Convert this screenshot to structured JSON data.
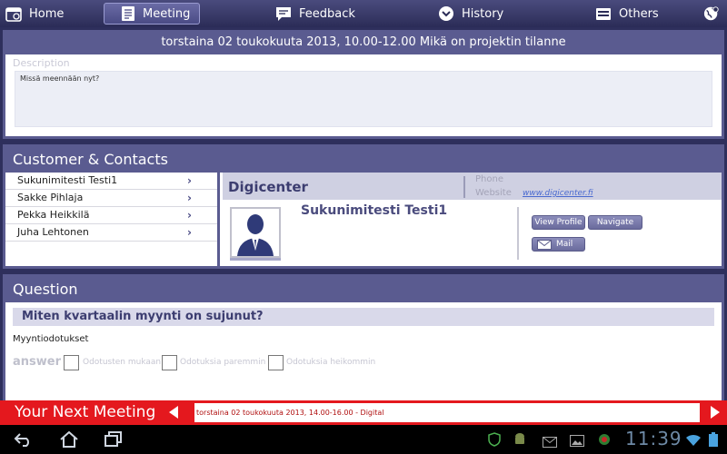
{
  "nav": {
    "home": "Home",
    "meeting": "Meeting",
    "feedback": "Feedback",
    "history": "History",
    "others": "Others"
  },
  "meeting": {
    "title": "torstaina 02 toukokuuta 2013, 10.00-12.00  Mikä on projektin tilanne",
    "description_label": "Description",
    "description_text": "Missä meennään nyt?"
  },
  "contacts": {
    "section_title": "Customer & Contacts",
    "list": [
      "Sukunimitesti Testi1",
      "Sakke Pihlaja",
      "Pekka Heikkilä",
      "Juha Lehtonen"
    ],
    "company": "Digicenter",
    "phone_label": "Phone",
    "website_label": "Website",
    "website_value": "www.digicenter.fi",
    "person_name": "Sukunimitesti Testi1",
    "view_profile": "View Profile",
    "navigate": "Navigate",
    "mail": "Mail"
  },
  "question": {
    "section_title": "Question",
    "text": "Miten kvartaalin myynti on sujunut?",
    "label": "Myyntiodotukset",
    "answer_label": "answer",
    "options": [
      "Odotusten mukaan",
      "Odotuksia paremmin",
      "Odotuksia heikommin"
    ]
  },
  "next_meeting": {
    "title": "Your Next Meeting",
    "text": "torstaina 02 toukokuuta 2013, 14.00-16.00 - Digital"
  },
  "system": {
    "clock": "11:39"
  },
  "colors": {
    "accent": "#5a5b90",
    "next_bar": "#e4181e"
  }
}
